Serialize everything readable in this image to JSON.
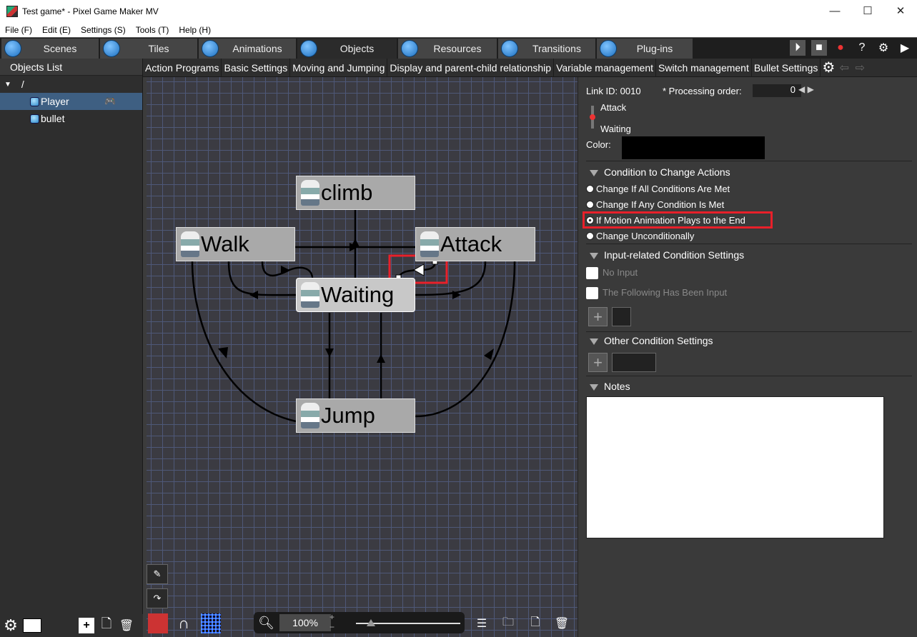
{
  "window": {
    "title": "Test game* - Pixel Game Maker MV"
  },
  "menu": [
    "File (F)",
    "Edit (E)",
    "Settings (S)",
    "Tools (T)",
    "Help (H)"
  ],
  "main_tabs": [
    {
      "label": "Scenes"
    },
    {
      "label": "Tiles"
    },
    {
      "label": "Animations"
    },
    {
      "label": "Objects"
    },
    {
      "label": "Resources"
    },
    {
      "label": "Transitions"
    },
    {
      "label": "Plug-ins"
    }
  ],
  "objects_list": {
    "header": "Objects List",
    "root": "/",
    "items": [
      {
        "label": "Player"
      },
      {
        "label": "bullet"
      }
    ]
  },
  "sub_tabs": [
    "Action Programs",
    "Basic Settings",
    "Moving and Jumping",
    "Display and parent-child relationship",
    "Variable management",
    "Switch management",
    "Bullet Settings"
  ],
  "nodes": {
    "climb": "climb",
    "walk": "Walk",
    "attack": "Attack",
    "waiting": "Waiting",
    "jump": "Jump"
  },
  "zoom": {
    "value": "100%"
  },
  "link_panel": {
    "link_id": "Link ID: 0010",
    "processing_order_label": "* Processing order:",
    "processing_order_value": "0",
    "from": "Attack",
    "to": "Waiting",
    "color_label": "Color:",
    "color_value": "#000000",
    "condition_header": "Condition to Change Actions",
    "conditions": [
      {
        "label": "Change If All Conditions Are Met",
        "selected": false
      },
      {
        "label": "Change If Any Condition Is Met",
        "selected": false
      },
      {
        "label": "If Motion Animation Plays to the End",
        "selected": true
      },
      {
        "label": "Change Unconditionally",
        "selected": false
      }
    ],
    "input_header": "Input-related Condition Settings",
    "no_input": "No Input",
    "following_input": "The Following Has Been Input",
    "other_header": "Other Condition Settings",
    "notes_header": "Notes",
    "notes_value": ""
  }
}
